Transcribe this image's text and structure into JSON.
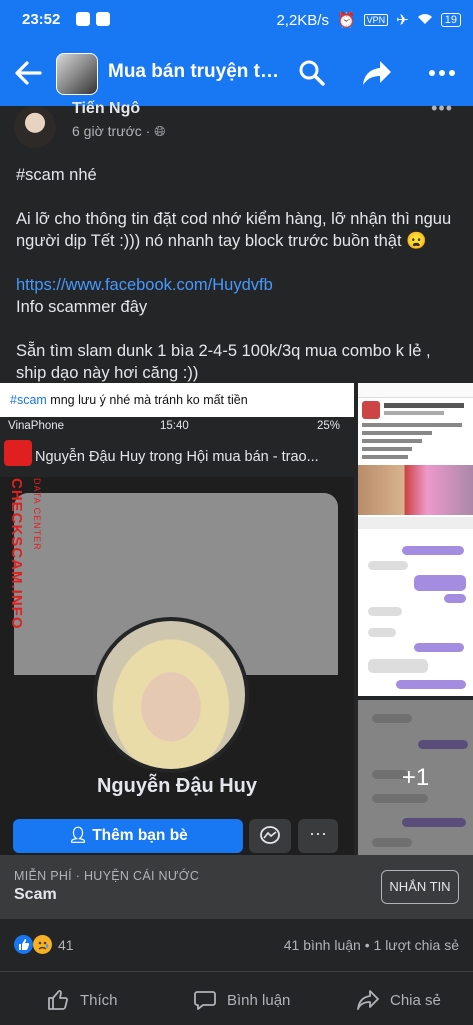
{
  "status_bar": {
    "time": "23:52",
    "net_speed": "2,2KB/s",
    "vpn": "VPN",
    "battery": "19"
  },
  "app_bar": {
    "title": "Mua bán truyện tranh tiệm Gấu"
  },
  "post": {
    "author": "Tiến Ngô",
    "time": "6 giờ trước",
    "privacy_dot": "·",
    "paragraphs": [
      "#scam nhé",
      "Ai lỡ cho thông tin đặt cod nhớ kiểm hàng, lỡ nhận thì nguu người dịp Tết :))) nó nhanh tay block trước buồn thật 😦"
    ],
    "link": "https://www.facebook.com/Huydvfb",
    "info_line": "Info scammer đây",
    "last_paragraph": "Sẵn tìm slam dunk 1 bìa 2-4-5 100k/3q mua combo k lẻ , ship dạo này hơi căng :))"
  },
  "photo_main": {
    "caption_tag": "#scam",
    "caption_text": " mng lưu ý nhé mà tránh ko mất tiền",
    "carrier": "VinaPhone",
    "time": "15:40",
    "battery": "25%",
    "header_title": "Nguyễn Đậu Huy trong Hội mua bán - trao...",
    "watermark_big": "CHECKSCAM.INFO",
    "watermark_small": "DATA CENTER",
    "profile_name": "Nguyễn Đậu Huy",
    "add_friend_label": "Thêm bạn bè",
    "more_label": "···"
  },
  "more_photos": {
    "label": "+1"
  },
  "listing": {
    "meta": "MIỄN PHÍ · HUYỆN CÁI NƯỚC",
    "title": "Scam",
    "message_button": "NHẮN TIN"
  },
  "stats": {
    "reactions": "41",
    "comments": "41 bình luận",
    "shares": "1 lượt chia sẻ",
    "separator": "•"
  },
  "actions": {
    "like": "Thích",
    "comment": "Bình luận",
    "share": "Chia sẻ"
  },
  "colors": {
    "brand": "#1877f2",
    "background": "#242526",
    "surface": "#3a3b3c",
    "link": "#4599ff",
    "watermark": "#e02020"
  }
}
